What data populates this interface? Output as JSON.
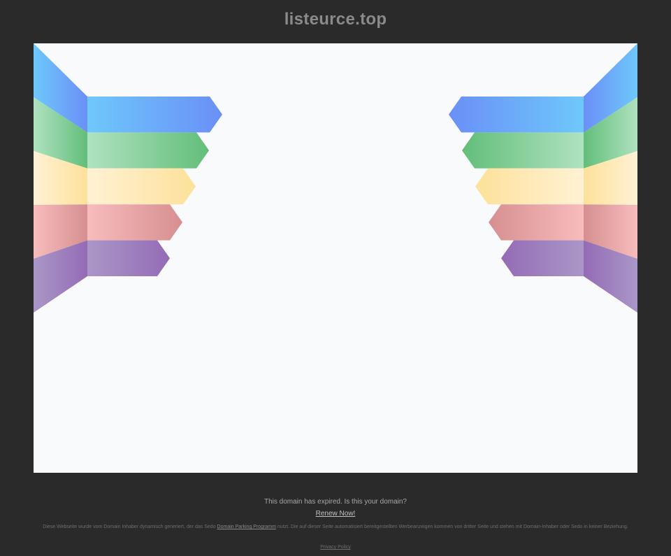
{
  "header": {
    "domain": "listeurce.top"
  },
  "banner": {
    "stripe_colors": [
      {
        "light": "#6ec8fb",
        "dark": "#6a8ff7"
      },
      {
        "light": "#b0e2c0",
        "dark": "#62be7a"
      },
      {
        "light": "#fff1d4",
        "dark": "#fde19a"
      },
      {
        "light": "#f8bcbd",
        "dark": "#d68f90"
      },
      {
        "light": "#aa97c7",
        "dark": "#946bb6"
      }
    ]
  },
  "footer": {
    "expired_message": "This domain has expired. Is this your domain?",
    "renew_label": "Renew Now!",
    "disclaimer_before": "Diese Webseite wurde vom Domain Inhaber dynamisch generiert, der das Sedo ",
    "disclaimer_link": "Domain Parking Programm",
    "disclaimer_after": " nutzt. Die auf dieser Seite automatisiert bereitgestellten Werbeanzeigen kommen von dritter Seite und stehen mit Domain-Inhaber oder Sedo in keiner Beziehung.",
    "privacy_label": "Privacy Policy"
  }
}
